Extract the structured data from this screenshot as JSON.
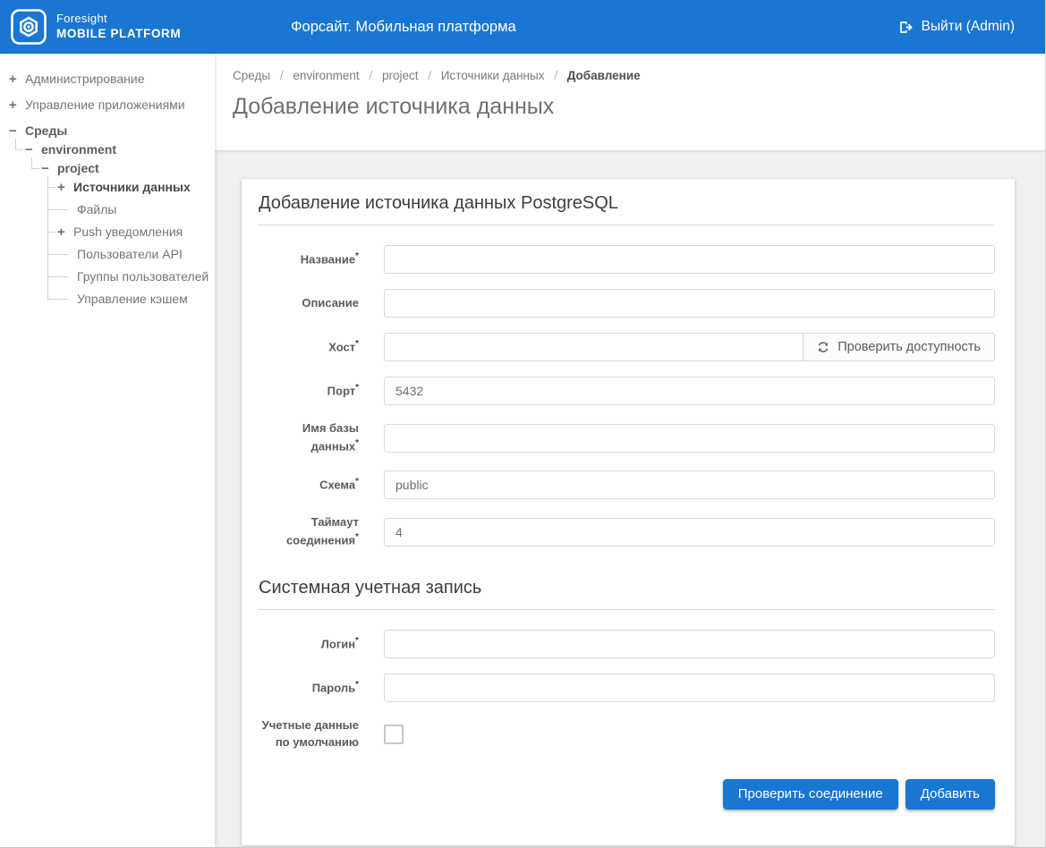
{
  "header": {
    "logo": {
      "line1": "Foresight",
      "line2": "MOBILE PLATFORM",
      "icon": "foresight-logo-icon"
    },
    "title": "Форсайт. Мобильная платформа",
    "logout": {
      "label": "Выйти (Admin)",
      "icon": "logout-icon"
    }
  },
  "colors": {
    "header_bg": "#1976d2",
    "button_primary": "#1976d2",
    "content_bg": "#f0f0f0",
    "card_bg": "#ffffff"
  },
  "sidebar": {
    "items": [
      {
        "label": "Администрирование",
        "state": "collapsed"
      },
      {
        "label": "Управление приложениями",
        "state": "collapsed"
      },
      {
        "label": "Среды",
        "state": "expanded"
      },
      {
        "label": "environment",
        "state": "expanded"
      },
      {
        "label": "project",
        "state": "expanded"
      },
      {
        "label": "Источники данных",
        "state": "collapsed"
      },
      {
        "label": "Файлы",
        "state": "leaf"
      },
      {
        "label": "Push уведомления",
        "state": "collapsed"
      },
      {
        "label": "Пользователи API",
        "state": "leaf"
      },
      {
        "label": "Группы пользователей",
        "state": "leaf"
      },
      {
        "label": "Управление кэшем",
        "state": "leaf"
      }
    ]
  },
  "breadcrumb": {
    "separator": "/",
    "items": [
      "Среды",
      "environment",
      "project",
      "Источники данных"
    ],
    "current": "Добавление"
  },
  "page": {
    "title": "Добавление источника данных"
  },
  "form": {
    "section1_title": "Добавление источника данных PostgreSQL",
    "section2_title": "Системная учетная запись",
    "required_mark": "*",
    "fields": {
      "name": {
        "label": "Название",
        "value": ""
      },
      "description": {
        "label": "Описание",
        "value": ""
      },
      "host": {
        "label": "Хост",
        "value": "",
        "check_button_label": "Проверить доступность",
        "check_button_icon": "refresh-icon"
      },
      "port": {
        "label": "Порт",
        "value": "5432"
      },
      "db_name": {
        "label": "Имя базы данных",
        "value": ""
      },
      "schema": {
        "label": "Схема",
        "value": "public"
      },
      "timeout": {
        "label": "Таймаут соединения",
        "value": "4"
      },
      "login": {
        "label": "Логин",
        "value": ""
      },
      "password": {
        "label": "Пароль",
        "value": ""
      },
      "default_credentials": {
        "label": "Учетные данные по умолчанию",
        "checked": false
      }
    },
    "buttons": {
      "test_connection": "Проверить соединение",
      "add": "Добавить"
    }
  }
}
